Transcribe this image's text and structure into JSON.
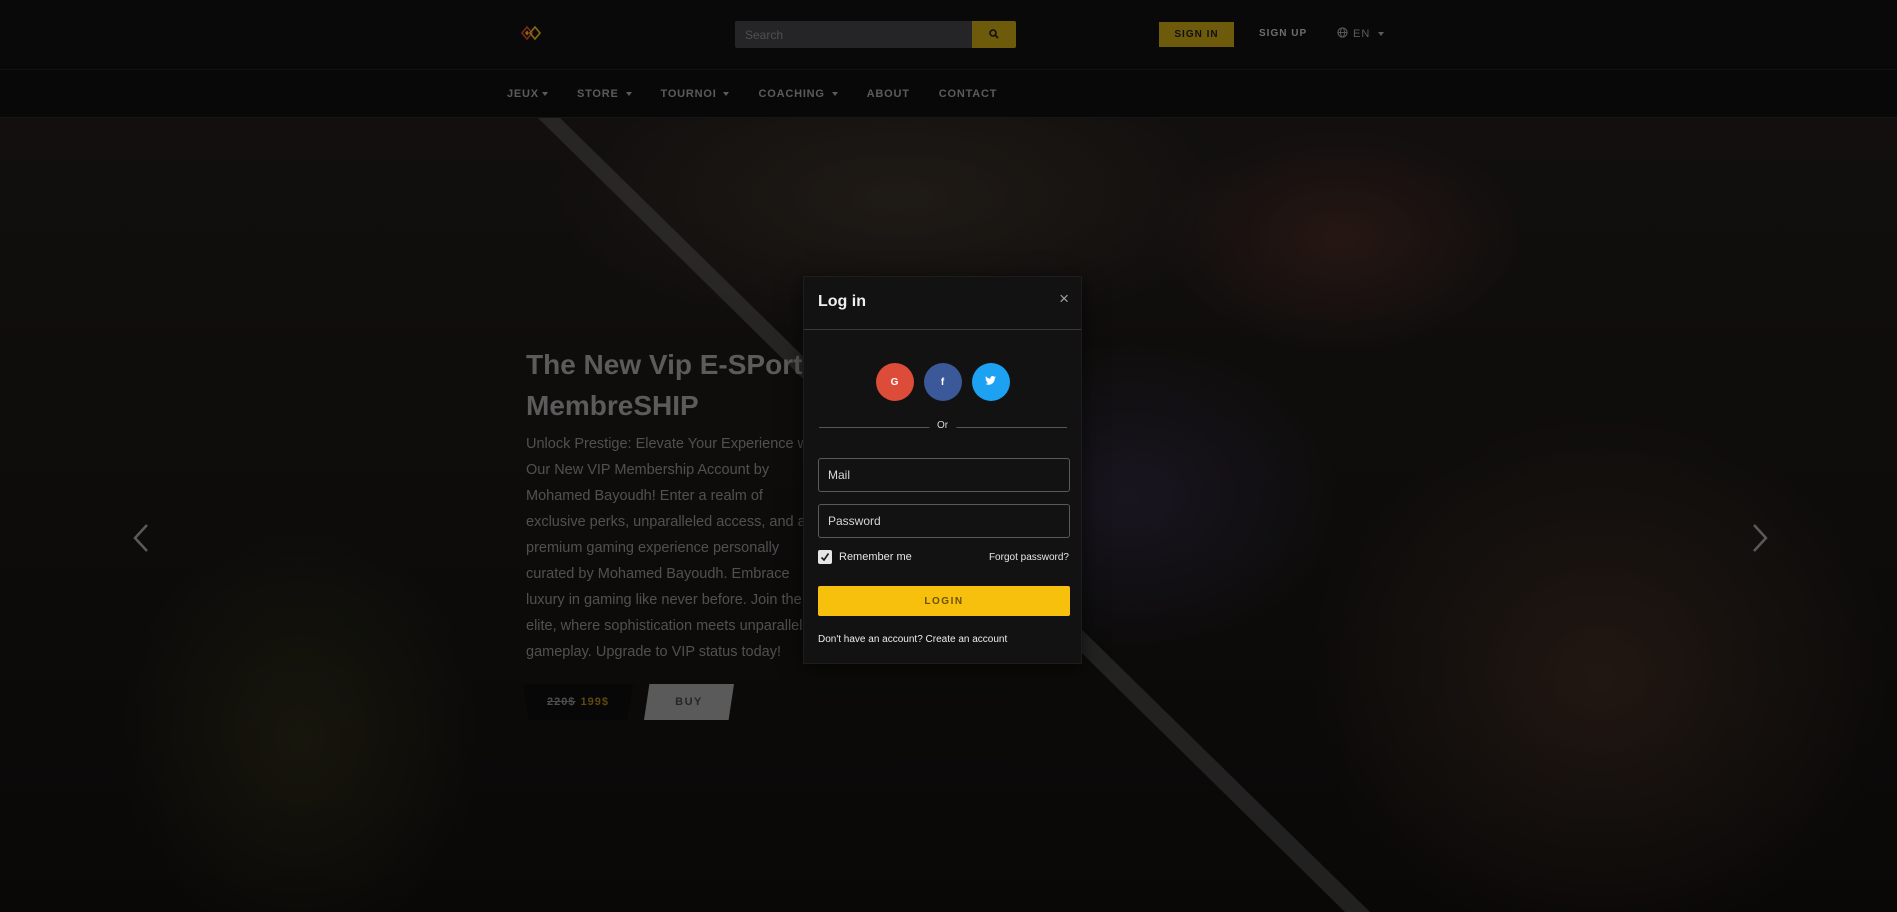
{
  "header": {
    "logo_icon": "diamond-logo-icon",
    "search_placeholder": "Search",
    "search_icon": "search-icon",
    "sign_in": "SIGN IN",
    "sign_up": "SIGN UP",
    "language": "EN",
    "accent_color": "#a88a12"
  },
  "nav": {
    "items": [
      {
        "label": "JEUX"
      },
      {
        "label": "STORE"
      },
      {
        "label": "TOURNOI"
      },
      {
        "label": "COACHING"
      },
      {
        "label": "ABOUT"
      },
      {
        "label": "CONTACT"
      }
    ]
  },
  "hero": {
    "title": "The New Vip E-SPorts MembreSHIP",
    "description": "Unlock Prestige: Elevate Your Experience with Our New VIP Membership Account by Mohamed Bayoudh! Enter a realm of exclusive perks, unparalleled access, and a premium gaming experience personally curated by Mohamed Bayoudh. Embrace luxury in gaming like never before. Join the elite, where sophistication meets unparalleled gameplay. Upgrade to VIP status today!",
    "old_price": "220$",
    "new_price": "199$",
    "buy_label": "BUY"
  },
  "modal": {
    "title": "Log in",
    "close_glyph": "×",
    "socials": [
      {
        "name": "google",
        "glyph": "G",
        "color": "#dd4b39"
      },
      {
        "name": "facebook",
        "glyph": "f",
        "color": "#3b5998"
      },
      {
        "name": "twitter",
        "glyph": "t",
        "color": "#1da1f2"
      }
    ],
    "divider_text": "Or",
    "mail_placeholder": "Mail",
    "password_placeholder": "Password",
    "remember_label": "Remember me",
    "remember_checked": true,
    "forgot_label": "Forgot password?",
    "login_label": "LOGIN",
    "no_account_text": "Don't have an account?",
    "create_account_link": "Create an account",
    "login_color": "#f6c00d"
  }
}
